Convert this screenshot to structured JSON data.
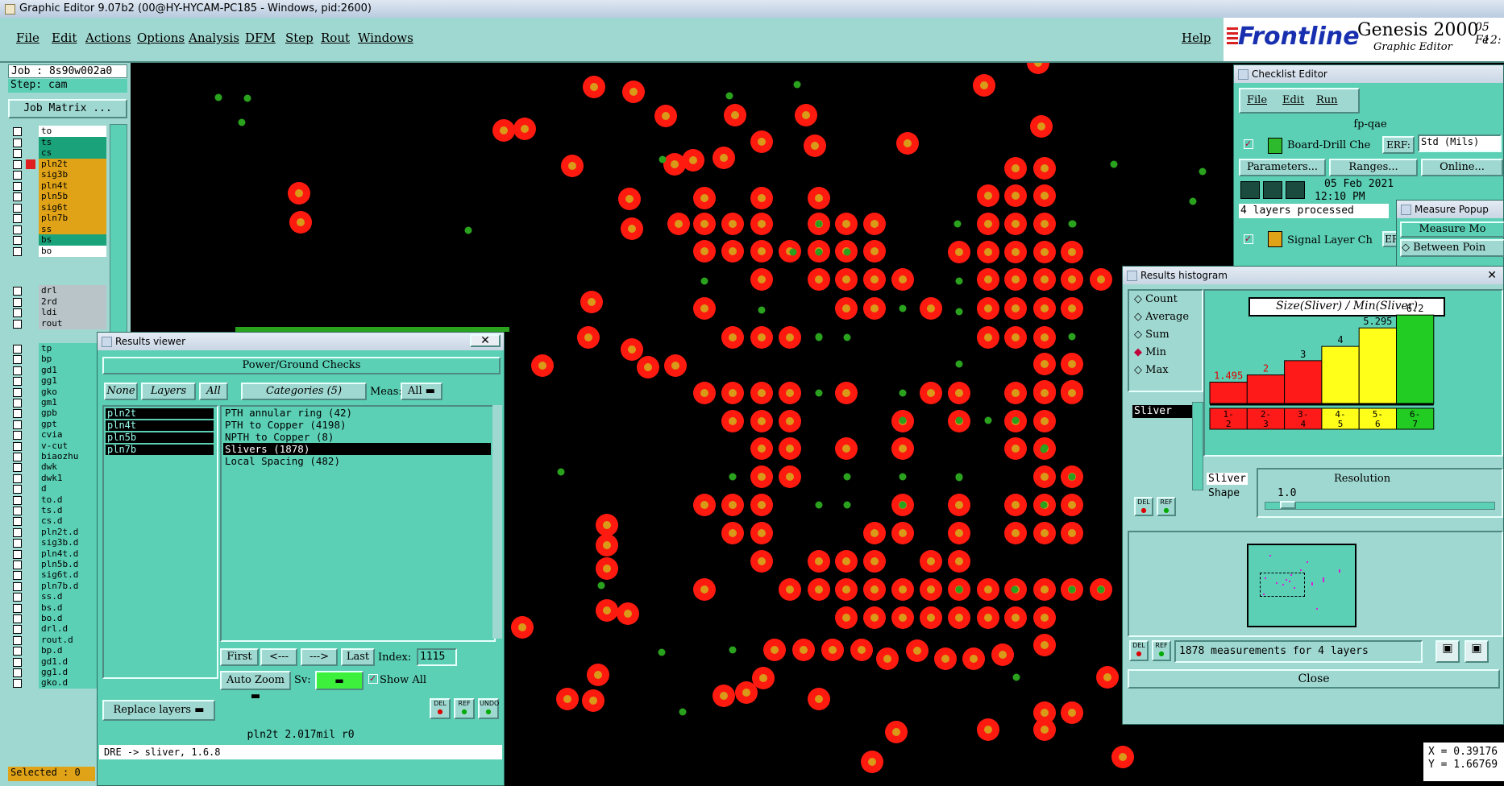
{
  "window_title": "Graphic Editor 9.07b2 (00@HY-HYCAM-PC185 - Windows, pid:2600)",
  "menu": [
    "File",
    "Edit",
    "Actions",
    "Options",
    "Analysis",
    "DFM",
    "Step",
    "Rout",
    "Windows"
  ],
  "help_label": "Help",
  "brand": {
    "logo": "Frontline",
    "product": "Genesis 2000",
    "subtitle": "Graphic Editor",
    "date": "05 Fe",
    "time": "12:"
  },
  "job": {
    "job_label": "Job : 8s90w002a0",
    "step_label": "Step: cam",
    "matrix_button": "Job Matrix ..."
  },
  "layers_group1": [
    {
      "name": "to",
      "color": "#ffffff"
    },
    {
      "name": "ts",
      "color": "#1aa37a"
    },
    {
      "name": "cs",
      "color": "#1aa37a"
    },
    {
      "name": "pln2t",
      "color": "#e0a318"
    },
    {
      "name": "sig3b",
      "color": "#e0a318"
    },
    {
      "name": "pln4t",
      "color": "#e0a318"
    },
    {
      "name": "pln5b",
      "color": "#e0a318"
    },
    {
      "name": "sig6t",
      "color": "#e0a318"
    },
    {
      "name": "pln7b",
      "color": "#e0a318"
    },
    {
      "name": "ss",
      "color": "#e0a318"
    },
    {
      "name": "bs",
      "color": "#1aa37a"
    },
    {
      "name": "bo",
      "color": "#ffffff"
    }
  ],
  "layers_group2": [
    {
      "name": "drl",
      "color": "#b8c4c8"
    },
    {
      "name": "2rd",
      "color": "#b8c4c8"
    },
    {
      "name": "ldi",
      "color": "#b8c4c8"
    },
    {
      "name": "rout",
      "color": "#b8c4c8"
    }
  ],
  "layers_group3": [
    "tp",
    "bp",
    "gd1",
    "gg1",
    "gko",
    "gm1",
    "gpb",
    "gpt",
    "cvia",
    "v-cut",
    "biaozhu",
    "dwk",
    "dwk1",
    "d",
    "to.d",
    "ts.d",
    "cs.d",
    "pln2t.d",
    "sig3b.d",
    "pln4t.d",
    "pln5b.d",
    "sig6t.d",
    "pln7b.d",
    "ss.d",
    "bs.d",
    "bo.d",
    "drl.d",
    "rout.d",
    "bp.d",
    "gd1.d",
    "gg1.d",
    "gko.d"
  ],
  "selected_label": "Selected : 0",
  "results_viewer": {
    "title": "Results viewer",
    "header": "Power/Ground Checks",
    "none_btn": "None",
    "layers_btn": "Layers",
    "all_btn": "All",
    "categories_btn": "Categories (5)",
    "meas_label": "Meas:",
    "meas_value": "All",
    "layers": [
      "pln2t",
      "pln4t",
      "pln5b",
      "pln7b"
    ],
    "categories": [
      "PTH annular ring (42)",
      "PTH to Copper (4198)",
      "NPTH to Copper (8)",
      "Slivers (1878)",
      "Local Spacing (482)"
    ],
    "selected_category": 3,
    "first_btn": "First",
    "prev_btn": "<---",
    "next_btn": "--->",
    "last_btn": "Last",
    "index_label": "Index:",
    "index_value": "1115",
    "auto_zoom": "Auto Zoom",
    "sv_label": "Sv:",
    "show_all": "Show All",
    "replace_layers": "Replace layers",
    "del": "DEL",
    "ref": "REF",
    "undo": "UNDO",
    "status": "pln2t  2.017mil  r0",
    "bottom_text": "DRE -> sliver, 1.6.8"
  },
  "checklist": {
    "title": "Checklist Editor",
    "menu": [
      "File",
      "Edit",
      "Run"
    ],
    "name": "fp-qae",
    "row1": "Board-Drill Che",
    "erf_label": "ERF:",
    "erf_value": "Std (Mils)",
    "parameters": "Parameters...",
    "ranges": "Ranges...",
    "online": "Online...",
    "date": "05 Feb 2021",
    "time": "12:10 PM",
    "processed": "4 layers processed",
    "row2": "Signal Layer Ch",
    "row2_erf": "ER"
  },
  "measure": {
    "title": "Measure Popup",
    "mode": "Measure Mo",
    "between": "Between Poin"
  },
  "histogram": {
    "title": "Results histogram",
    "options": [
      "Count",
      "Average",
      "Sum",
      "Min",
      "Max"
    ],
    "selected_option": 3,
    "sliver_item": "Sliver",
    "chart_title": "Size(Sliver) / Min(Sliver)",
    "sliver_shape_1": "Sliver",
    "sliver_shape_2": "Shape",
    "resolution_label": "Resolution",
    "resolution_value": "1.0",
    "measurements": "1878 measurements for 4 layers",
    "close": "Close",
    "del": "DEL",
    "ref": "REF"
  },
  "chart_data": {
    "type": "bar",
    "title": "Size(Sliver) / Min(Sliver)",
    "categories": [
      "1-2",
      "2-3",
      "3-4",
      "4-5",
      "5-6",
      "6-7"
    ],
    "values": [
      1.495,
      2,
      3,
      4,
      5.295,
      6.2
    ],
    "value_labels": [
      "1.495",
      "2",
      "3",
      "4",
      "5.295",
      "6.2"
    ],
    "colors": [
      "#ff1a1a",
      "#ff1a1a",
      "#ff1a1a",
      "#ffff1a",
      "#ffff1a",
      "#22cc22"
    ],
    "ylim": [
      0,
      7
    ]
  },
  "coords": {
    "x": "X = 0.39176",
    "y": "Y = 1.66769"
  }
}
